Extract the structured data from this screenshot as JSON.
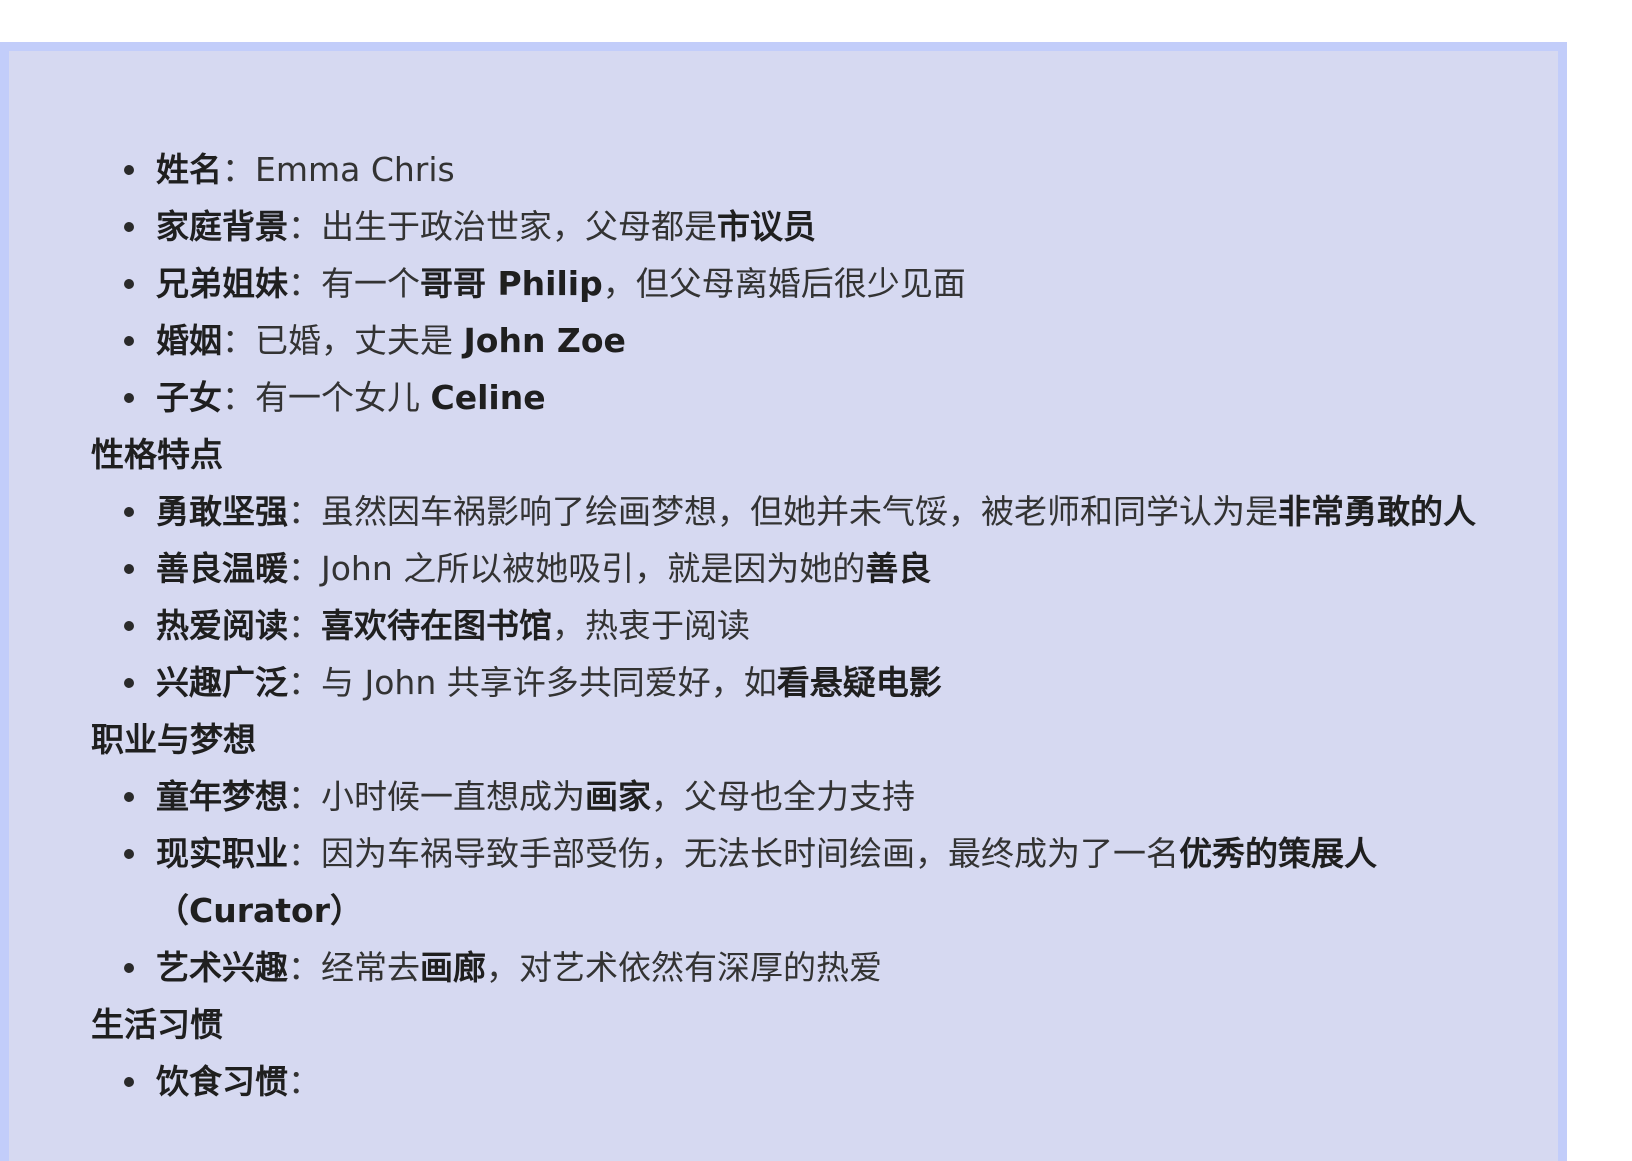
{
  "basic_info": [
    {
      "label": "姓名",
      "sep": "：",
      "parts": [
        {
          "t": "Emma Chris"
        }
      ]
    },
    {
      "label": "家庭背景",
      "sep": "：",
      "parts": [
        {
          "t": "出生于政治世家，父母都是"
        },
        {
          "t": "市议员",
          "b": true
        }
      ]
    },
    {
      "label": "兄弟姐妹",
      "sep": "：",
      "parts": [
        {
          "t": "有一个"
        },
        {
          "t": "哥哥 Philip",
          "b": true
        },
        {
          "t": "，但父母离婚后很少见面"
        }
      ]
    },
    {
      "label": "婚姻",
      "sep": "：",
      "parts": [
        {
          "t": "已婚，丈夫是 "
        },
        {
          "t": "John Zoe",
          "b": true
        }
      ]
    },
    {
      "label": "子女",
      "sep": "：",
      "parts": [
        {
          "t": "有一个女儿 "
        },
        {
          "t": "Celine",
          "b": true
        }
      ]
    }
  ],
  "sections": [
    {
      "heading": "性格特点",
      "items": [
        {
          "label": "勇敢坚强",
          "sep": "：",
          "parts": [
            {
              "t": "虽然因车祸影响了绘画梦想，但她并未气馁，被老师和同学认为是"
            },
            {
              "t": "非常勇敢的人",
              "b": true
            }
          ]
        },
        {
          "label": "善良温暖",
          "sep": "：",
          "parts": [
            {
              "t": "John 之所以被她吸引，就是因为她的"
            },
            {
              "t": "善良",
              "b": true
            }
          ]
        },
        {
          "label": "热爱阅读",
          "sep": "：",
          "parts": [
            {
              "t": "喜欢待在图书馆",
              "b": true
            },
            {
              "t": "，热衷于阅读"
            }
          ]
        },
        {
          "label": "兴趣广泛",
          "sep": "：",
          "parts": [
            {
              "t": "与 John 共享许多共同爱好，如"
            },
            {
              "t": "看悬疑电影",
              "b": true
            }
          ]
        }
      ]
    },
    {
      "heading": "职业与梦想",
      "items": [
        {
          "label": "童年梦想",
          "sep": "：",
          "parts": [
            {
              "t": "小时候一直想成为"
            },
            {
              "t": "画家",
              "b": true
            },
            {
              "t": "，父母也全力支持"
            }
          ]
        },
        {
          "label": "现实职业",
          "sep": "：",
          "parts": [
            {
              "t": "因为车祸导致手部受伤，无法长时间绘画，最终成为了一名"
            },
            {
              "t": "优秀的策展人（Curator）",
              "b": true
            }
          ]
        },
        {
          "label": "艺术兴趣",
          "sep": "：",
          "parts": [
            {
              "t": "经常去"
            },
            {
              "t": "画廊",
              "b": true
            },
            {
              "t": "，对艺术依然有深厚的热爱"
            }
          ]
        }
      ]
    },
    {
      "heading": "生活习惯",
      "items": [
        {
          "label": "饮食习惯",
          "sep": "：",
          "parts": []
        }
      ]
    }
  ]
}
